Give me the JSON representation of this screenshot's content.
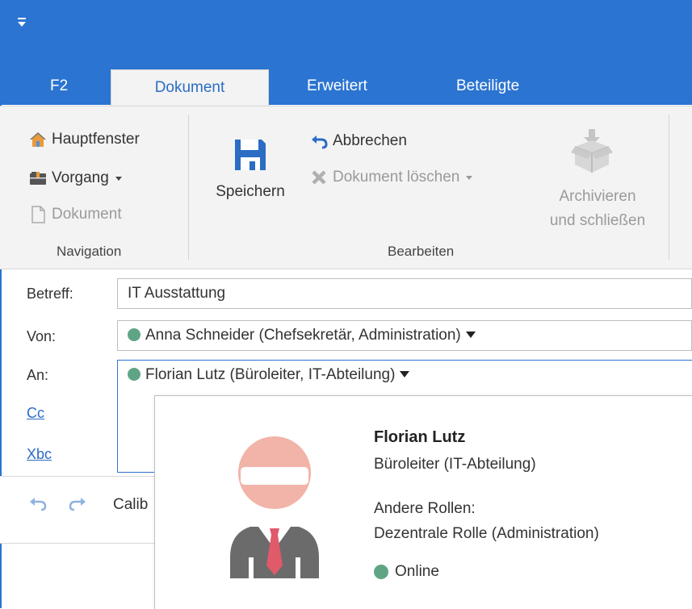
{
  "ribbon_tabs": [
    {
      "label": "F2",
      "active": false
    },
    {
      "label": "Dokument",
      "active": true
    },
    {
      "label": "Erweitert",
      "active": false
    },
    {
      "label": "Beteiligte",
      "active": false
    }
  ],
  "navigation": {
    "group_label": "Navigation",
    "items": [
      {
        "label": "Hauptfenster",
        "icon": "home-icon",
        "enabled": true
      },
      {
        "label": "Vorgang",
        "icon": "folder-icon",
        "enabled": true,
        "has_dropdown": true
      },
      {
        "label": "Dokument",
        "icon": "document-icon",
        "enabled": false
      }
    ]
  },
  "bearbeiten": {
    "group_label": "Bearbeiten",
    "save_label": "Speichern",
    "cancel_label": "Abbrechen",
    "delete_label": "Dokument löschen",
    "archive_label_line1": "Archivieren",
    "archive_label_line2": "und schließen"
  },
  "form": {
    "subject_label": "Betreff:",
    "subject_value": "IT Ausstattung",
    "from_label": "Von:",
    "from_value": "Anna Schneider (Chefsekretär, Administration)",
    "to_label": "An:",
    "to_value": "Florian Lutz (Büroleiter, IT-Abteilung)",
    "cc_label": "Cc",
    "xbc_label": "Xbc"
  },
  "editor": {
    "font_name": "Calib"
  },
  "contact_card": {
    "name": "Florian Lutz",
    "role": "Büroleiter (IT-Abteilung)",
    "other_roles_heading": "Andere Rollen:",
    "other_role": "Dezentrale Rolle (Administration)",
    "status": "Online",
    "status_color": "#5fa585"
  },
  "colors": {
    "accent": "#2b74d1",
    "link": "#2b6cc4",
    "online": "#5fa585"
  }
}
